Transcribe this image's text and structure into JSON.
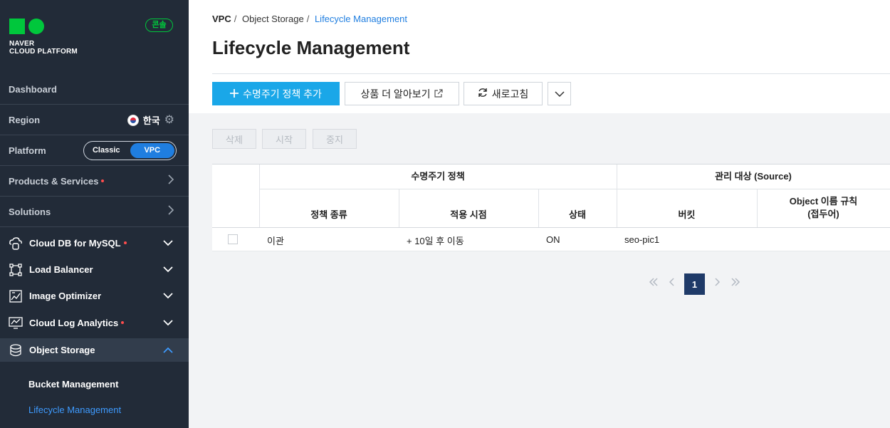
{
  "brand": {
    "logo_text_line1": "NAVER",
    "logo_text_line2": "CLOUD PLATFORM",
    "console_badge": "콘솔",
    "brand_color": "#00c73c"
  },
  "sidebar": {
    "dashboard": "Dashboard",
    "region_label": "Region",
    "region_value": "한국",
    "platform_label": "Platform",
    "platform_options": [
      "Classic",
      "VPC"
    ],
    "platform_selected": "VPC",
    "products_services": "Products & Services",
    "solutions": "Solutions",
    "services": [
      {
        "label": "Cloud DB for MySQL",
        "icon": "cloud-db-icon",
        "new_dot": true
      },
      {
        "label": "Load Balancer",
        "icon": "load-balancer-icon",
        "new_dot": false
      },
      {
        "label": "Image Optimizer",
        "icon": "image-optimizer-icon",
        "new_dot": false
      },
      {
        "label": "Cloud Log Analytics",
        "icon": "log-analytics-icon",
        "new_dot": true
      },
      {
        "label": "Object Storage",
        "icon": "object-storage-icon",
        "new_dot": false
      }
    ],
    "sub_items": [
      "Bucket Management",
      "Lifecycle Management"
    ],
    "current_sub_item": "Lifecycle Management"
  },
  "breadcrumb": [
    "VPC",
    "Object Storage",
    "Lifecycle Management"
  ],
  "page_title": "Lifecycle Management",
  "toolbar": {
    "add_policy": "수명주기 정책 추가",
    "learn_more": "상품 더 알아보기",
    "refresh": "새로고침"
  },
  "actions": {
    "delete": "삭제",
    "start": "시작",
    "stop": "중지"
  },
  "table": {
    "group_policy": "수명주기 정책",
    "group_target": "관리 대상 (Source)",
    "columns": [
      "정책 종류",
      "적용 시점",
      "상태",
      "버킷",
      "Object 이름 규칙\n(접두어)"
    ],
    "rows": [
      {
        "type": "이관",
        "timing": "+ 10일 후 이동",
        "status": "ON",
        "bucket": "seo-pic1",
        "prefix": ""
      }
    ]
  },
  "pagination": {
    "current_page": "1"
  },
  "colors": {
    "sidebar_bg": "#222b38",
    "accent": "#1f7ee0",
    "primary_button": "#1aa7e8",
    "page_active": "#1f3a68"
  }
}
